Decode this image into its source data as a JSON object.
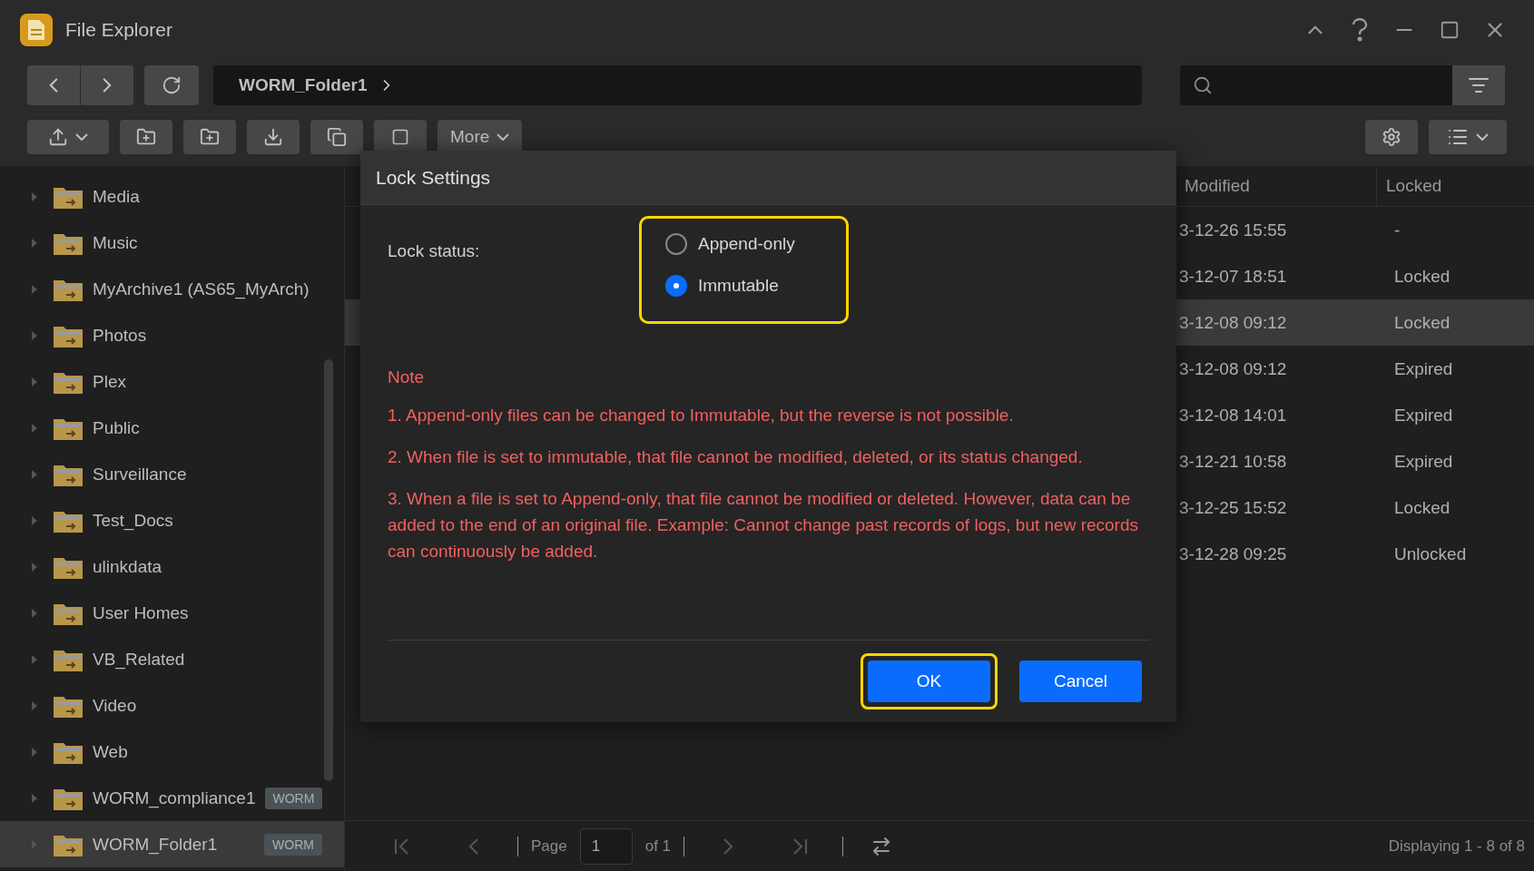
{
  "window": {
    "title": "File Explorer"
  },
  "path": {
    "segments": [
      "WORM_Folder1"
    ]
  },
  "toolbar": {
    "more_label": "More"
  },
  "sidebar": {
    "items": [
      {
        "label": "Media",
        "selected": false
      },
      {
        "label": "Music",
        "selected": false
      },
      {
        "label": "MyArchive1 (AS65_MyArch)",
        "selected": false
      },
      {
        "label": "Photos",
        "selected": false
      },
      {
        "label": "Plex",
        "selected": false
      },
      {
        "label": "Public",
        "selected": false
      },
      {
        "label": "Surveillance",
        "selected": false
      },
      {
        "label": "Test_Docs",
        "selected": false
      },
      {
        "label": "ulinkdata",
        "selected": false
      },
      {
        "label": "User Homes",
        "selected": false
      },
      {
        "label": "VB_Related",
        "selected": false
      },
      {
        "label": "Video",
        "selected": false
      },
      {
        "label": "Web",
        "selected": false
      },
      {
        "label": "WORM_compliance1",
        "badge": "WORM",
        "selected": false
      },
      {
        "label": "WORM_Folder1",
        "badge": "WORM",
        "selected": true
      }
    ]
  },
  "table": {
    "columns": [
      "Modified",
      "Locked"
    ],
    "rows": [
      {
        "modified": "3-12-26 15:55",
        "locked": "-",
        "selected": false
      },
      {
        "modified": "3-12-07 18:51",
        "locked": "Locked",
        "selected": false
      },
      {
        "modified": "3-12-08 09:12",
        "locked": "Locked",
        "selected": true
      },
      {
        "modified": "3-12-08 09:12",
        "locked": "Expired",
        "selected": false
      },
      {
        "modified": "3-12-08 14:01",
        "locked": "Expired",
        "selected": false
      },
      {
        "modified": "3-12-21 10:58",
        "locked": "Expired",
        "selected": false
      },
      {
        "modified": "3-12-25 15:52",
        "locked": "Locked",
        "selected": false
      },
      {
        "modified": "3-12-28 09:25",
        "locked": "Unlocked",
        "selected": false
      }
    ]
  },
  "dialog": {
    "title": "Lock Settings",
    "field_label": "Lock status:",
    "options_highlighted": true,
    "options": [
      {
        "label": "Append-only",
        "selected": false
      },
      {
        "label": "Immutable",
        "selected": true
      }
    ],
    "note_title": "Note",
    "notes": [
      "1. Append-only files can be changed to Immutable, but the reverse is not possible.",
      "2. When file is set to immutable, that file cannot be modified, deleted, or its status changed.",
      "3. When a file is set to Append-only, that file cannot be modified or deleted. However, data can be added to the end of an original file. Example: Cannot change past records of logs, but new records can continuously be added."
    ],
    "buttons": [
      {
        "label": "OK",
        "kind": "primary",
        "highlighted": true
      },
      {
        "label": "Cancel",
        "kind": "primary",
        "highlighted": false
      }
    ]
  },
  "pager": {
    "page_label": "Page",
    "page": "1",
    "of_label": "of 1",
    "summary": "Displaying 1 - 8 of 8"
  }
}
